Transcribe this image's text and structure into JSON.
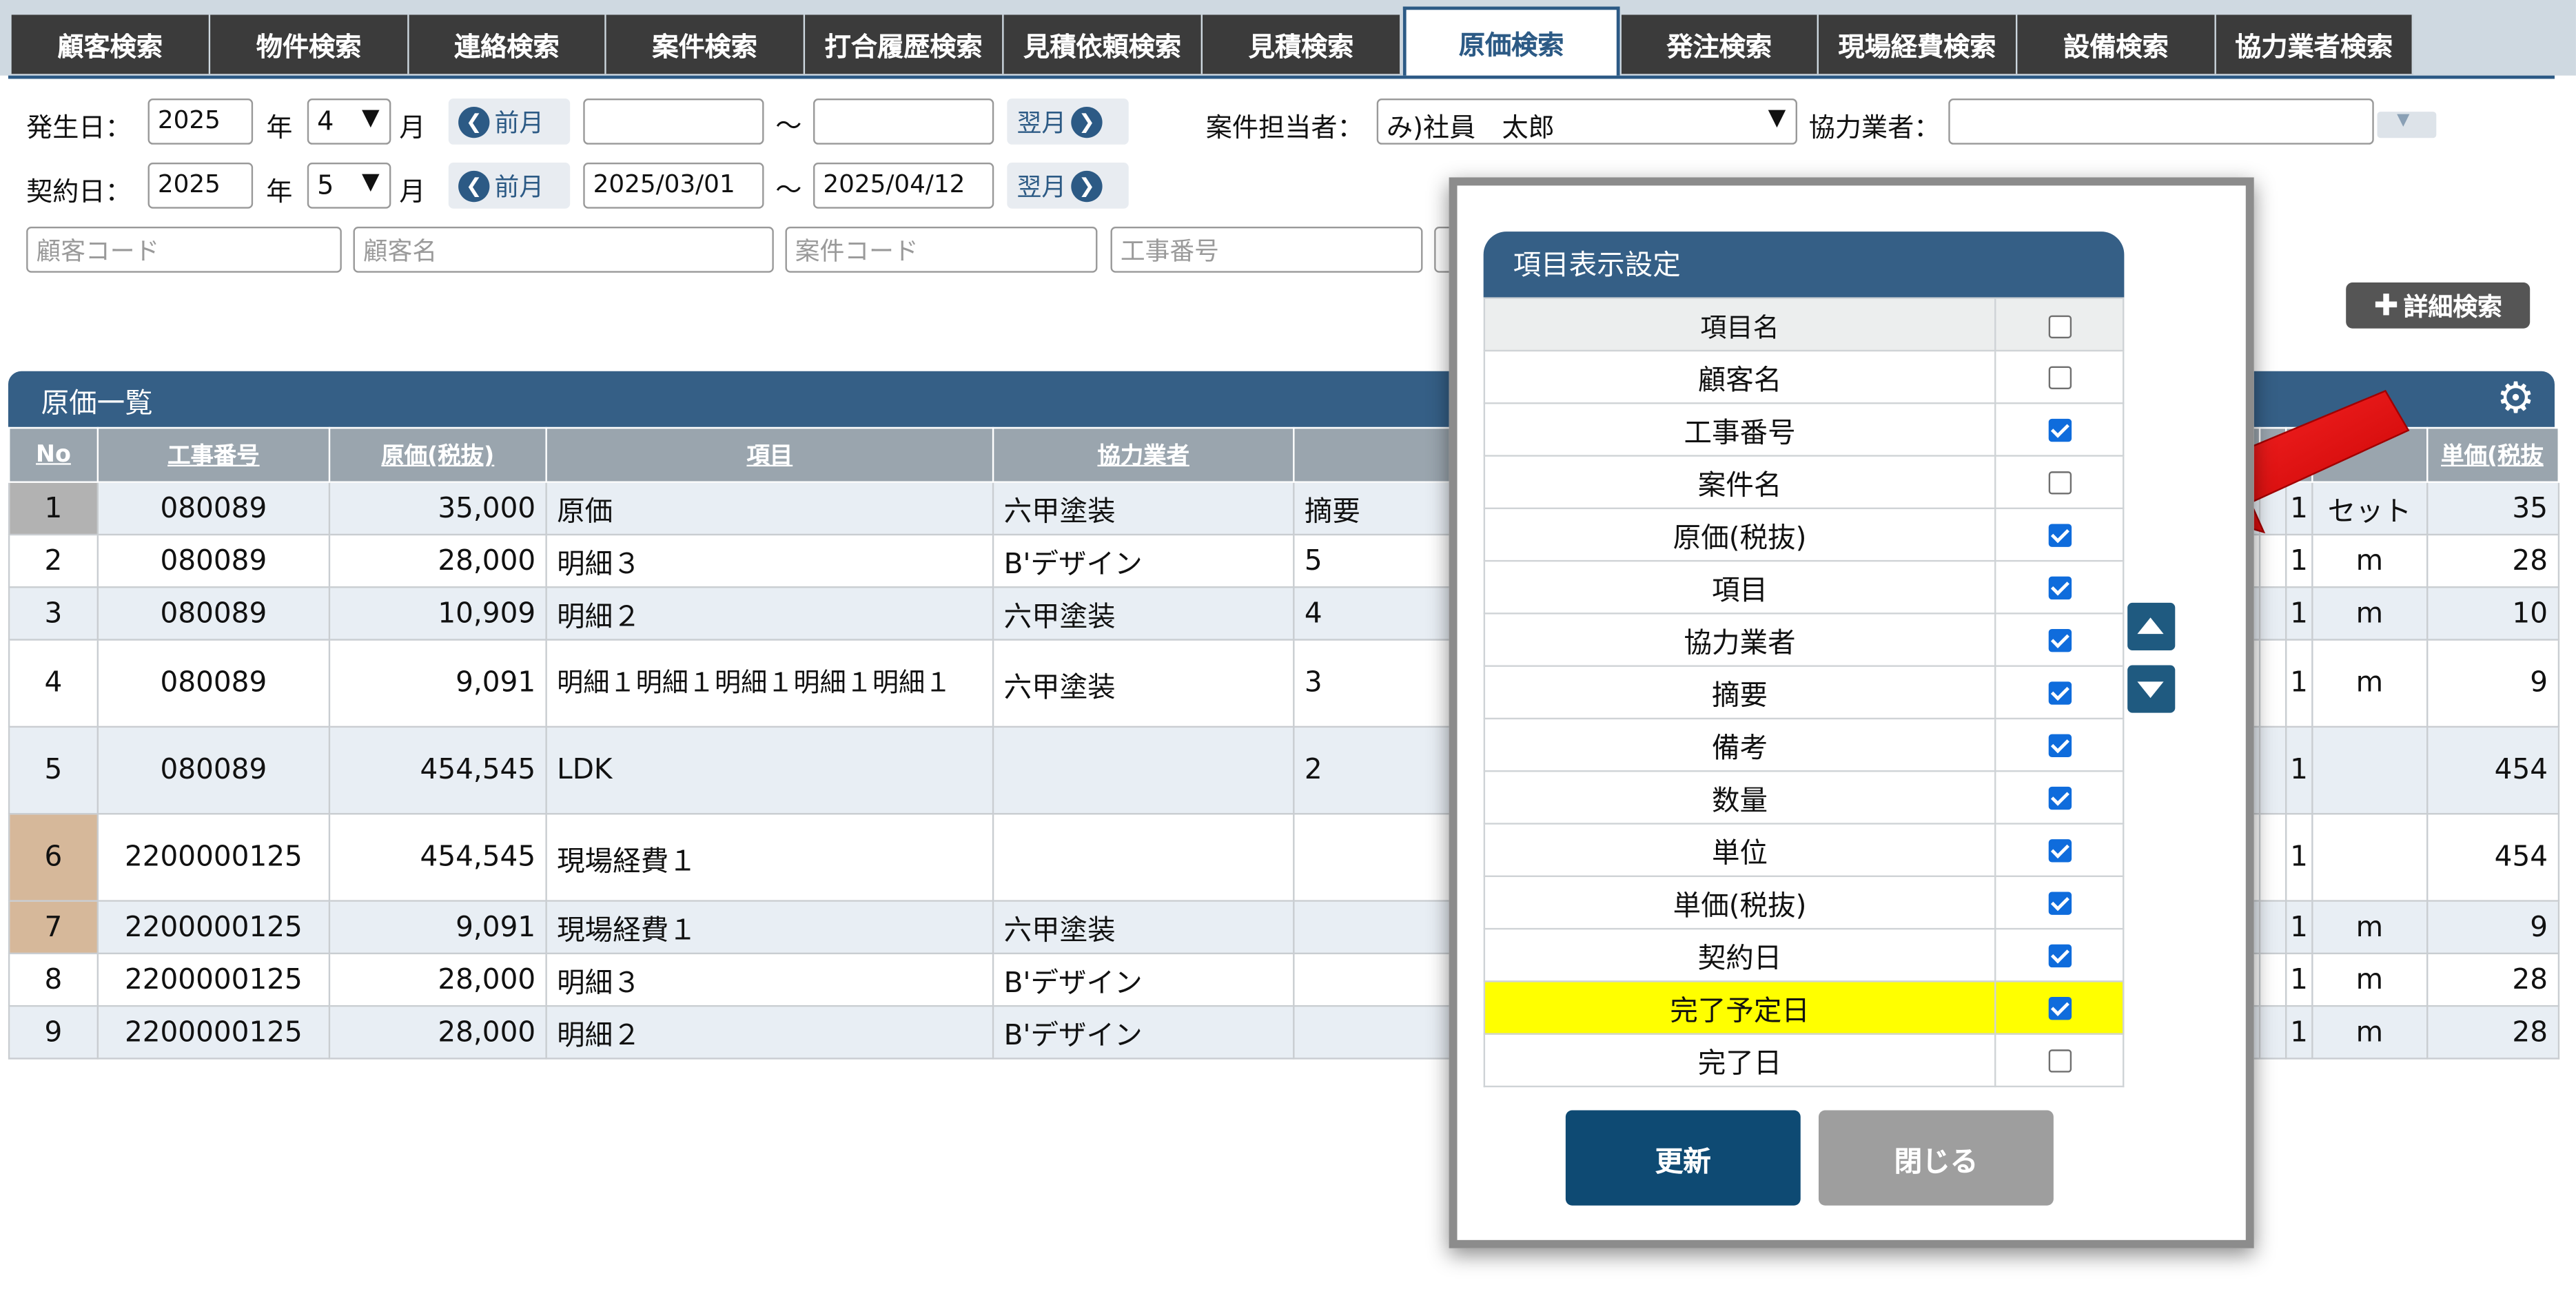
{
  "tabs": [
    {
      "label": "顧客検索",
      "active": false
    },
    {
      "label": "物件検索",
      "active": false
    },
    {
      "label": "連絡検索",
      "active": false
    },
    {
      "label": "案件検索",
      "active": false
    },
    {
      "label": "打合履歴検索",
      "active": false
    },
    {
      "label": "見積依頼検索",
      "active": false
    },
    {
      "label": "見積検索",
      "active": false
    },
    {
      "label": "原価検索",
      "active": true
    },
    {
      "label": "発注検索",
      "active": false
    },
    {
      "label": "現場経費検索",
      "active": false
    },
    {
      "label": "設備検索",
      "active": false
    },
    {
      "label": "協力業者検索",
      "active": false
    }
  ],
  "search": {
    "occ_label": "発生日：",
    "occ_year": "2025",
    "year_unit": "年",
    "occ_month": "4",
    "month_unit": "月",
    "prev_label": "前月",
    "next_label": "翌月",
    "tilde": "～",
    "occ_from": "",
    "occ_to": "",
    "con_label": "契約日：",
    "con_year": "2025",
    "con_month": "5",
    "con_from": "2025/03/01",
    "con_to": "2025/04/12",
    "staff_label": "案件担当者：",
    "staff_value": "み)社員　太郎",
    "partner_label": "協力業者：",
    "partner_value": "",
    "ph_customer_code": "顧客コード",
    "ph_customer_name": "顧客名",
    "ph_project_code": "案件コード",
    "ph_work_no": "工事番号",
    "detail_btn": "詳細検索"
  },
  "list": {
    "title": "原価一覧",
    "columns": [
      "No",
      "工事番号",
      "原価(税抜)",
      "項目",
      "協力業者",
      "",
      "",
      "単価(税抜"
    ],
    "rows": [
      {
        "no": "1",
        "work": "080089",
        "cost": "35,000",
        "item": "原価",
        "partner": "六甲塗装",
        "memo": "摘要",
        "qty": "1",
        "unit": "セット",
        "price": "35"
      },
      {
        "no": "2",
        "work": "080089",
        "cost": "28,000",
        "item": "明細３",
        "partner": "B'デザイン",
        "memo": "5",
        "qty": "1",
        "unit": "m",
        "price": "28"
      },
      {
        "no": "3",
        "work": "080089",
        "cost": "10,909",
        "item": "明細２",
        "partner": "六甲塗装",
        "memo": "4",
        "qty": "1",
        "unit": "m",
        "price": "10"
      },
      {
        "no": "4",
        "work": "080089",
        "cost": "9,091",
        "item": "明細１明細１明細１明細１明細１",
        "partner": "六甲塗装",
        "memo": "3",
        "qty": "1",
        "unit": "m",
        "price": "9"
      },
      {
        "no": "5",
        "work": "080089",
        "cost": "454,545",
        "item": "LDK",
        "partner": "",
        "memo": "2",
        "qty": "1",
        "unit": "",
        "price": "454"
      },
      {
        "no": "6",
        "work": "2200000125",
        "cost": "454,545",
        "item": "現場経費１",
        "partner": "",
        "memo": "",
        "qty": "1",
        "unit": "",
        "price": "454"
      },
      {
        "no": "7",
        "work": "2200000125",
        "cost": "9,091",
        "item": "現場経費１",
        "partner": "六甲塗装",
        "memo": "",
        "qty": "1",
        "unit": "m",
        "price": "9"
      },
      {
        "no": "8",
        "work": "2200000125",
        "cost": "28,000",
        "item": "明細３",
        "partner": "B'デザイン",
        "memo": "",
        "qty": "1",
        "unit": "m",
        "price": "28"
      },
      {
        "no": "9",
        "work": "2200000125",
        "cost": "28,000",
        "item": "明細２",
        "partner": "B'デザイン",
        "memo": "",
        "qty": "1",
        "unit": "m",
        "price": "28"
      }
    ]
  },
  "dialog": {
    "title": "項目表示設定",
    "header_name": "項目名",
    "items": [
      {
        "name": "顧客名",
        "checked": false,
        "highlight": false
      },
      {
        "name": "工事番号",
        "checked": true,
        "highlight": false
      },
      {
        "name": "案件名",
        "checked": false,
        "highlight": false
      },
      {
        "name": "原価(税抜)",
        "checked": true,
        "highlight": false
      },
      {
        "name": "項目",
        "checked": true,
        "highlight": false
      },
      {
        "name": "協力業者",
        "checked": true,
        "highlight": false
      },
      {
        "name": "摘要",
        "checked": true,
        "highlight": false
      },
      {
        "name": "備考",
        "checked": true,
        "highlight": false
      },
      {
        "name": "数量",
        "checked": true,
        "highlight": false
      },
      {
        "name": "単位",
        "checked": true,
        "highlight": false
      },
      {
        "name": "単価(税抜)",
        "checked": true,
        "highlight": false
      },
      {
        "name": "契約日",
        "checked": true,
        "highlight": false
      },
      {
        "name": "完了予定日",
        "checked": true,
        "highlight": true
      },
      {
        "name": "完了日",
        "checked": false,
        "highlight": false
      }
    ],
    "update_btn": "更新",
    "close_btn": "閉じる"
  },
  "colors": {
    "primary": "#355f86",
    "highlight": "#ffff00",
    "checkbox": "#0f6cdc",
    "arrow": "#e30000"
  }
}
